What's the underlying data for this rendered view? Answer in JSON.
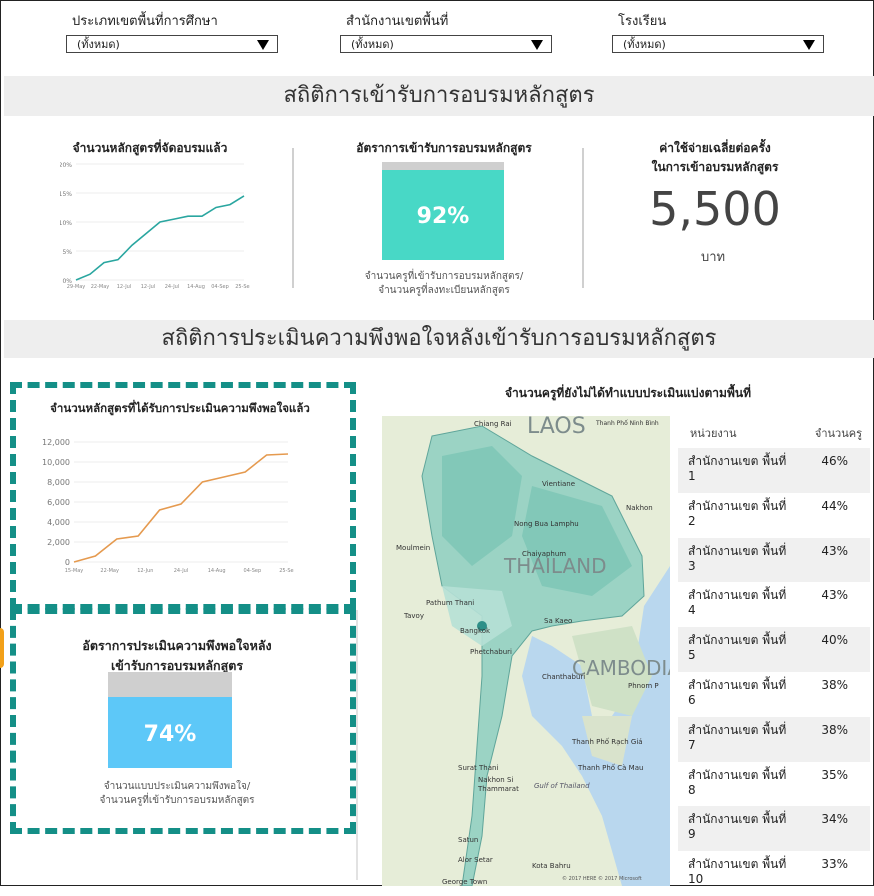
{
  "filters": [
    {
      "label": "ประเภทเขตพื้นที่การศึกษา",
      "value": "(ทั้งหมด)"
    },
    {
      "label": "สำนักงานเขตพื้นที่",
      "value": "(ทั้งหมด)"
    },
    {
      "label": "โรงเรียน",
      "value": "(ทั้งหมด)"
    }
  ],
  "section1": {
    "title": "สถิติการเข้ารับการอบรมหลักสูตร"
  },
  "kpi1": {
    "title": "จำนวนหลักสูตรที่จัดอบรมแล้ว",
    "yticks": [
      "20%",
      "15%",
      "10%",
      "5%",
      "0%"
    ],
    "xticks": [
      "29-May",
      "22-May",
      "12-Jul",
      "12-Jul",
      "24-Jul",
      "14-Aug",
      "04-Sep",
      "25-Sep"
    ]
  },
  "kpi2": {
    "title": "อัตราการเข้ารับการอบรมหลักสูตร",
    "value": "92%",
    "fraction": 0.92,
    "note_line1": "จำนวนครูที่เข้ารับการอบรมหลักสูตร/",
    "note_line2": "จำนวนครูที่ลงทะเบียนหลักสูตร"
  },
  "kpi3": {
    "title_line1": "ค่าใช้จ่ายเฉลี่ยต่อครั้ง",
    "title_line2": "ในการเข้าอบรมหลักสูตร",
    "value": "5,500",
    "unit": "บาท"
  },
  "section2": {
    "title": "สถิติการประเมินความพึงพอใจหลังเข้ารับการอบรมหลักสูตร"
  },
  "chart2": {
    "title": "จำนวนหลักสูตรที่ได้รับการประเมินความพึงพอใจแล้ว",
    "yticks": [
      "12,000",
      "10,000",
      "8,000",
      "6,000",
      "4,000",
      "2,000",
      "0"
    ],
    "xticks": [
      "15-May",
      "22-May",
      "12-Jun",
      "24-Jul",
      "14-Aug",
      "04-Sep",
      "25-Sep"
    ]
  },
  "kpi4": {
    "title_line1": "อัตราการประเมินความพึงพอใจหลัง",
    "title_line2": "เข้ารับการอบรมหลักสูตร",
    "value": "74%",
    "fraction": 0.74,
    "note_line1": "จำนวนแบบประเมินความพึงพอใจ/",
    "note_line2": "จำนวนครูที่เข้ารับการอบรมหลักสูตร"
  },
  "map": {
    "title": "จำนวนครูที่ยังไม่ได้ทำแบบประเมินแบ่งตามพื้นที่",
    "labels": [
      "Chiang Rai",
      "LAOS",
      "Thanh Phố Ninh Bình",
      "Vientiane",
      "Nakhon",
      "Nong Bua Lamphu",
      "Chaiyaphum",
      "THAILAND",
      "Pathum Thani",
      "Bangkok",
      "Sa Kaeo",
      "CAMBODIA",
      "Phnom P",
      "Surat Thani",
      "Nakhon Si Thammarat",
      "Gulf of Thailand",
      "Kota Bahru",
      "Moulmein",
      "Tavoy",
      "Phetchaburi",
      "Chanthaburi",
      "Thanh Phố Rạch Giá",
      "Thanh Phố Cà Mau",
      "Alor Setar",
      "Satun",
      "George Town",
      "© 2017 HERE  © 2017 Microsoft"
    ]
  },
  "table": {
    "headers": [
      "หน่วยงาน",
      "จำนวนครู"
    ],
    "rows": [
      {
        "name": "สำนักงานเขต พื้นที่ 1",
        "value": "46%"
      },
      {
        "name": "สำนักงานเขต พื้นที่ 2",
        "value": "44%"
      },
      {
        "name": "สำนักงานเขต พื้นที่ 3",
        "value": "43%"
      },
      {
        "name": "สำนักงานเขต พื้นที่ 4",
        "value": "43%"
      },
      {
        "name": "สำนักงานเขต พื้นที่ 5",
        "value": "40%"
      },
      {
        "name": "สำนักงานเขต พื้นที่ 6",
        "value": "38%"
      },
      {
        "name": "สำนักงานเขต พื้นที่ 7",
        "value": "38%"
      },
      {
        "name": "สำนักงานเขต พื้นที่ 8",
        "value": "35%"
      },
      {
        "name": "สำนักงานเขต พื้นที่ 9",
        "value": "34%"
      },
      {
        "name": "สำนักงานเขต พื้นที่ 10",
        "value": "33%"
      }
    ]
  },
  "colors": {
    "teal": "#48d8c6",
    "blue": "#5dc8f8",
    "line1": "#2aa6a0",
    "line2": "#e59a4f",
    "dash": "#148f87"
  },
  "chart_data": [
    {
      "type": "line",
      "title": "จำนวนหลักสูตรที่จัดอบรมแล้ว",
      "ylim": [
        0,
        20
      ],
      "x": [
        "29-May",
        "22-May",
        "12-Jul",
        "12-Jul",
        "24-Jul",
        "14-Aug",
        "04-Sep",
        "25-Sep"
      ],
      "values": [
        0,
        1,
        3,
        3.5,
        6,
        8,
        10,
        10.5,
        11,
        11,
        12.5,
        13,
        14.5
      ]
    },
    {
      "type": "line",
      "title": "จำนวนหลักสูตรที่ได้รับการประเมินความพึงพอใจแล้ว",
      "ylim": [
        0,
        12000
      ],
      "x": [
        "15-May",
        "22-May",
        "12-Jun",
        "24-Jul",
        "14-Aug",
        "04-Sep",
        "25-Sep"
      ],
      "values": [
        0,
        600,
        2300,
        2600,
        5200,
        5800,
        8000,
        8500,
        9000,
        10700,
        10800
      ]
    }
  ]
}
